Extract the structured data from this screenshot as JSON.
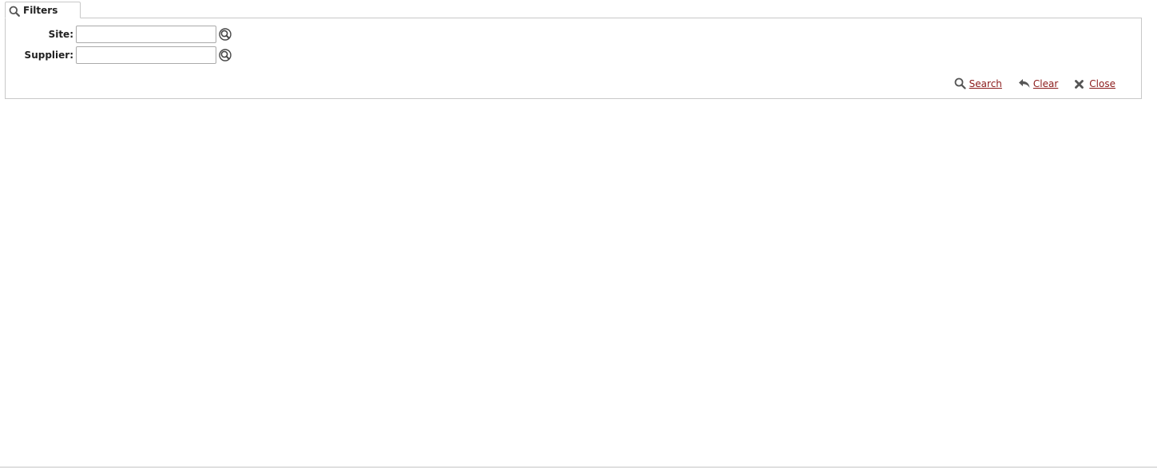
{
  "tab": {
    "label": "Filters",
    "icon": "search-icon"
  },
  "filters": {
    "site": {
      "label": "Site:",
      "value": "",
      "lookup_icon": "lookup-icon"
    },
    "supplier": {
      "label": "Supplier:",
      "value": "",
      "lookup_icon": "lookup-icon"
    }
  },
  "actions": {
    "search_label": "Search",
    "clear_label": "Clear",
    "close_label": "Close"
  },
  "colors": {
    "link": "#8b1a1a",
    "border": "#c8c8c8",
    "icon": "#555555"
  }
}
